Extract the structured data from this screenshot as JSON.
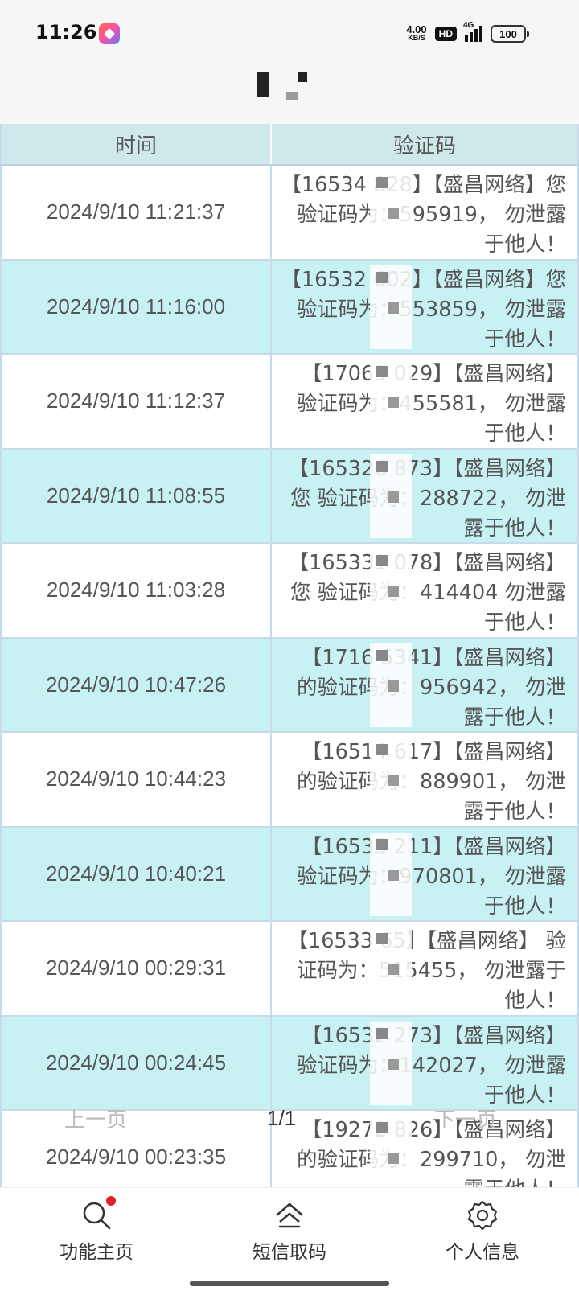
{
  "status_bar": {
    "time": "11:26",
    "speed_value": "4.00",
    "speed_unit": "KB/S",
    "hd_label": "HD",
    "network": "4G",
    "battery": "100"
  },
  "table": {
    "headers": {
      "time": "时间",
      "code": "验证码"
    },
    "rows": [
      {
        "time": "2024/9/10 11:21:37",
        "code": "【16534 828】【盛昌网络】您 验证码为：595919， 勿泄露于他人！"
      },
      {
        "time": "2024/9/10 11:16:00",
        "code": "【16532 602】【盛昌网络】您 验证码为：553859， 勿泄露于他人！"
      },
      {
        "time": "2024/9/10 11:12:37",
        "code": "【17069 029】【盛昌网络】 验证码为：455581， 勿泄露于他人！"
      },
      {
        "time": "2024/9/10 11:08:55",
        "code": "【165326 873】【盛昌网络】您 验证码为：288722， 勿泄露于他人！"
      },
      {
        "time": "2024/9/10 11:03:28",
        "code": "【165331 078】【盛昌网络】您 验证码为：414404 勿泄露于他人！"
      },
      {
        "time": "2024/9/10 10:47:26",
        "code": "【1716 5341】【盛昌网络】 的验证码为：956942， 勿泄露于他人！"
      },
      {
        "time": "2024/9/10 10:44:23",
        "code": "【16514 617】【盛昌网络】 的验证码为：889901， 勿泄露于他人！"
      },
      {
        "time": "2024/9/10 10:40:21",
        "code": "【16533 211】【盛昌网络】 验证码为：970801， 勿泄露于他人！"
      },
      {
        "time": "2024/9/10 00:29:31",
        "code": "【16533 65】【盛昌网络】 验证码为：515455， 勿泄露于他人！"
      },
      {
        "time": "2024/9/10 00:24:45",
        "code": "【16532 273】【盛昌网络】 验证码为：142027， 勿泄露于他人！"
      },
      {
        "time": "2024/9/10 00:23:35",
        "code": "【19272 826】【盛昌网络】 的验证码为：299710， 勿泄露于他人！"
      }
    ]
  },
  "pager": {
    "prev": "上一页",
    "page": "1/1",
    "next": "下一页"
  },
  "bottom_nav": [
    {
      "label": "功能主页",
      "icon": "search-icon"
    },
    {
      "label": "短信取码",
      "icon": "home-icon"
    },
    {
      "label": "个人信息",
      "icon": "gear-icon"
    }
  ],
  "colors": {
    "header_bg": "#cfe8ea",
    "alt_row_bg": "#c8f1f3",
    "badge_red": "#e0202a"
  }
}
